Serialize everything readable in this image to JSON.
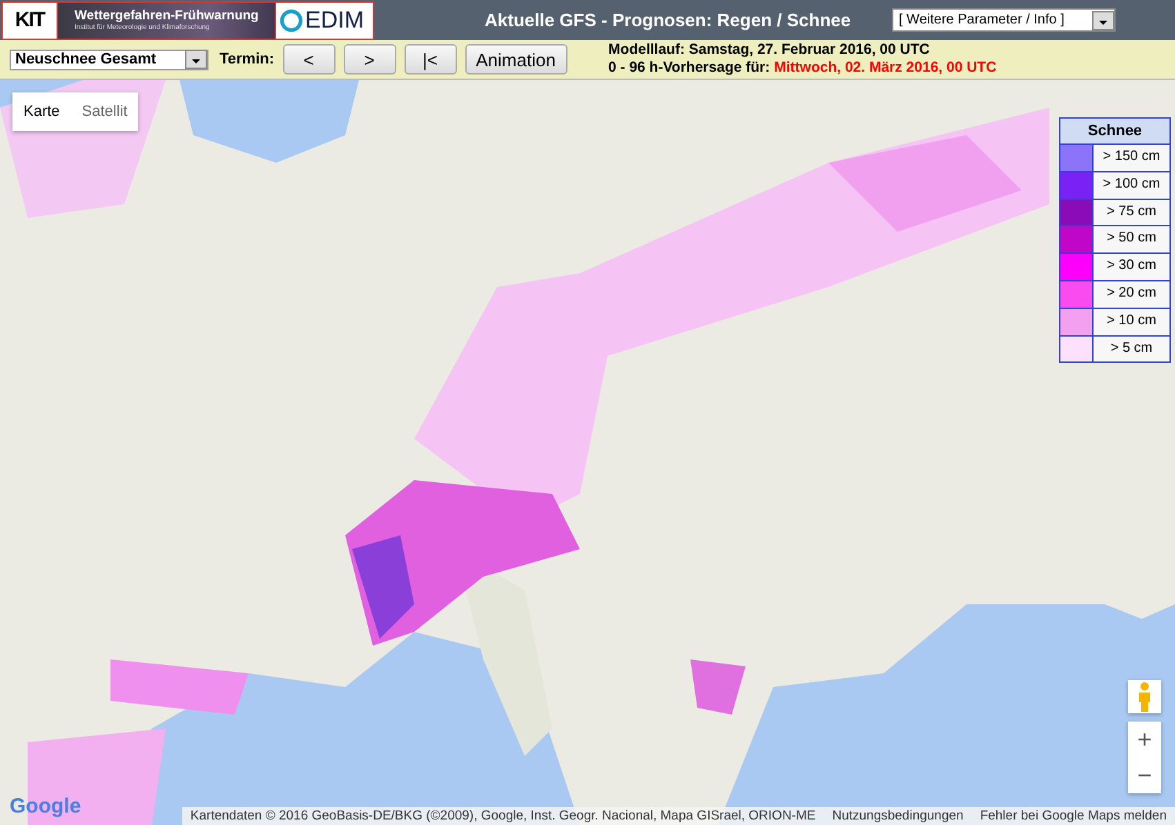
{
  "header": {
    "logos": {
      "kit": "KIT",
      "banner_title": "Wettergefahren-Frühwarnung",
      "banner_subtitle": "Institut für Meteorologie und Klimaforschung",
      "cedim": "EDIM"
    },
    "title": "Aktuelle GFS - Prognosen: Regen / Schnee",
    "menu": {
      "value": "[ Weitere Parameter / Info ]"
    }
  },
  "toolbar": {
    "parameter": {
      "value": "Neuschnee Gesamt"
    },
    "termin_label": "Termin:",
    "buttons": [
      "<",
      ">",
      "|<",
      "Animation"
    ],
    "model_run": "Modelllauf: Samstag, 27. Februar 2016, 00 UTC",
    "forecast": {
      "label": "0 - 96 h-Vorhersage für:",
      "value": "Mittwoch, 02. März 2016, 00 UTC"
    }
  },
  "map": {
    "kind": "picture",
    "map_types": [
      {
        "label": "Karte",
        "selected": true
      },
      {
        "label": "Satellit",
        "selected": false
      }
    ],
    "legend": {
      "title": "Schnee",
      "items": [
        {
          "label": "> 150 cm",
          "color": "#8c74f8"
        },
        {
          "label": "> 100 cm",
          "color": "#7a22f6"
        },
        {
          "label": "> 75 cm",
          "color": "#8a0bb8"
        },
        {
          "label": "> 50 cm",
          "color": "#c006c6"
        },
        {
          "label": "> 30 cm",
          "color": "#fc00fc"
        },
        {
          "label": "> 20 cm",
          "color": "#f84cf0"
        },
        {
          "label": "> 10 cm",
          "color": "#f4a0f0"
        },
        {
          "label": "> 5 cm",
          "color": "#fce0fc"
        }
      ]
    },
    "zoom": [
      "+",
      "−"
    ],
    "google_logo": "Google",
    "attribution": "Kartendaten © 2016 GeoBasis-DE/BKG (©2009), Google, Inst. Geogr. Nacional, Mapa GISrael, ORION-ME",
    "links": [
      "Nutzungsbedingungen",
      "Fehler bei Google Maps melden"
    ]
  }
}
